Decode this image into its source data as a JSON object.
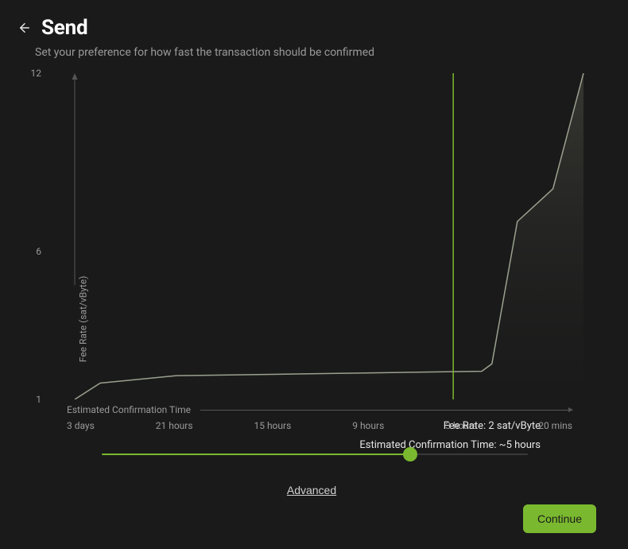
{
  "header": {
    "title": "Send",
    "subtitle": "Set your preference for how fast the transaction should be confirmed"
  },
  "chart_data": {
    "type": "line",
    "ylabel": "Fee Rate (sat/vByte)",
    "ylim": [
      1,
      12
    ],
    "y_ticks": [
      1,
      6,
      12
    ],
    "xlabel": "Estimated Confirmation Time",
    "categories": [
      "3 days",
      "21 hours",
      "15 hours",
      "9 hours",
      "3 hours",
      "20 mins"
    ],
    "series": [
      {
        "name": "Fee Rate",
        "values": [
          1.0,
          1.8,
          1.85,
          1.9,
          1.95,
          12.0
        ]
      }
    ],
    "points": [
      {
        "x_label": "3 days",
        "x": 0.0,
        "y": 1.0
      },
      {
        "x_label": "",
        "x": 0.05,
        "y": 1.55
      },
      {
        "x_label": "21 hours",
        "x": 0.2,
        "y": 1.8
      },
      {
        "x_label": "15 hours",
        "x": 0.4,
        "y": 1.85
      },
      {
        "x_label": "9 hours",
        "x": 0.6,
        "y": 1.9
      },
      {
        "x_label": "3 hours",
        "x": 0.8,
        "y": 1.95
      },
      {
        "x_label": "",
        "x": 0.82,
        "y": 2.2
      },
      {
        "x_label": "",
        "x": 0.87,
        "y": 7.0
      },
      {
        "x_label": "",
        "x": 0.94,
        "y": 8.1
      },
      {
        "x_label": "20 mins",
        "x": 1.0,
        "y": 12.0
      }
    ],
    "selection_x": 0.744
  },
  "readout": {
    "fee_rate_label": "Fee Rate: 2 sat/vByte",
    "time_label": "Estimated Confirmation Time: ~5  hours"
  },
  "slider": {
    "position": 0.724
  },
  "links": {
    "advanced": "Advanced"
  },
  "buttons": {
    "continue": "Continue"
  },
  "colors": {
    "accent": "#7ab92f",
    "line": "#9aa18f"
  }
}
